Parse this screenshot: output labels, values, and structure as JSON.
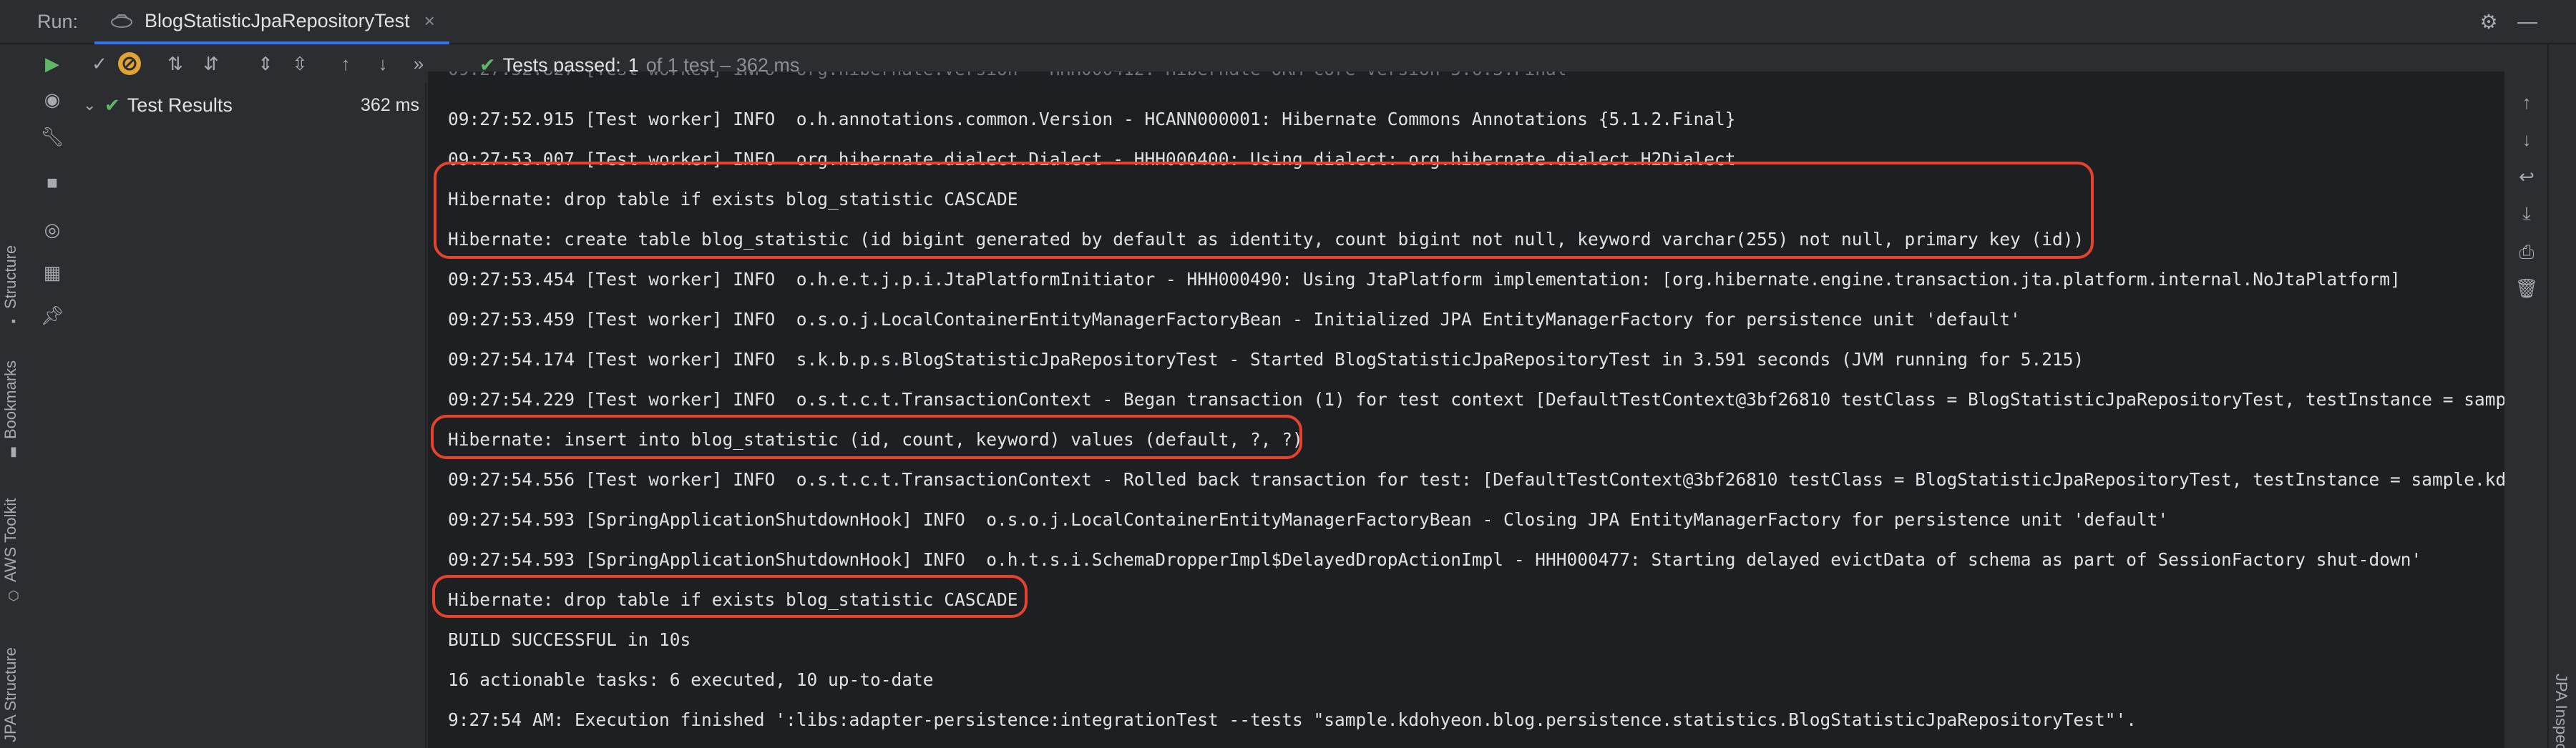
{
  "run_bar": {
    "label": "Run:",
    "tab_title": "BlogStatisticJpaRepositoryTest",
    "close_glyph": "×"
  },
  "toolbar": {
    "status_label": "Tests passed:",
    "status_count": "1",
    "status_detail": "of 1 test – 362 ms"
  },
  "tree": {
    "root_label": "Test Results",
    "root_time": "362 ms"
  },
  "left_strip": {
    "structure": "Structure",
    "bookmarks": "Bookmarks",
    "aws_toolkit": "AWS Toolkit",
    "jpa_structure": "JPA Structure"
  },
  "right_strip": {
    "jpa_inspector": "JPA Inspector"
  },
  "console": {
    "lines": [
      "09:27:52.915 [Test worker] INFO  o.h.annotations.common.Version - HCANN000001: Hibernate Commons Annotations {5.1.2.Final}",
      "09:27:53.007 [Test worker] INFO  org.hibernate.dialect.Dialect - HHH000400: Using dialect: org.hibernate.dialect.H2Dialect",
      "Hibernate: drop table if exists blog_statistic CASCADE",
      "Hibernate: create table blog_statistic (id bigint generated by default as identity, count bigint not null, keyword varchar(255) not null, primary key (id))",
      "09:27:53.454 [Test worker] INFO  o.h.e.t.j.p.i.JtaPlatformInitiator - HHH000490: Using JtaPlatform implementation: [org.hibernate.engine.transaction.jta.platform.internal.NoJtaPlatform]",
      "09:27:53.459 [Test worker] INFO  o.s.o.j.LocalContainerEntityManagerFactoryBean - Initialized JPA EntityManagerFactory for persistence unit 'default'",
      "09:27:54.174 [Test worker] INFO  s.k.b.p.s.BlogStatisticJpaRepositoryTest - Started BlogStatisticJpaRepositoryTest in 3.591 seconds (JVM running for 5.215)",
      "09:27:54.229 [Test worker] INFO  o.s.t.c.t.TransactionContext - Began transaction (1) for test context [DefaultTestContext@3bf26810 testClass = BlogStatisticJpaRepositoryTest, testInstance = sample.kd",
      "Hibernate: insert into blog_statistic (id, count, keyword) values (default, ?, ?)",
      "09:27:54.556 [Test worker] INFO  o.s.t.c.t.TransactionContext - Rolled back transaction for test: [DefaultTestContext@3bf26810 testClass = BlogStatisticJpaRepositoryTest, testInstance = sample.kdohyeo",
      "09:27:54.593 [SpringApplicationShutdownHook] INFO  o.s.o.j.LocalContainerEntityManagerFactoryBean - Closing JPA EntityManagerFactory for persistence unit 'default'",
      "09:27:54.593 [SpringApplicationShutdownHook] INFO  o.h.t.s.i.SchemaDropperImpl$DelayedDropActionImpl - HHH000477: Starting delayed evictData of schema as part of SessionFactory shut-down'",
      "Hibernate: drop table if exists blog_statistic CASCADE",
      "BUILD SUCCESSFUL in 10s",
      "16 actionable tasks: 6 executed, 10 up-to-date",
      "9:27:54 AM: Execution finished ':libs:adapter-persistence:integrationTest --tests \"sample.kdohyeon.blog.persistence.statistics.BlogStatisticJpaRepositoryTest\"'."
    ]
  },
  "colors": {
    "pass_green": "#5fb865",
    "run_green": "#5fb865",
    "stop_orange": "#e1a336",
    "highlight_red": "#e5432d",
    "accent_blue": "#3574f0"
  }
}
